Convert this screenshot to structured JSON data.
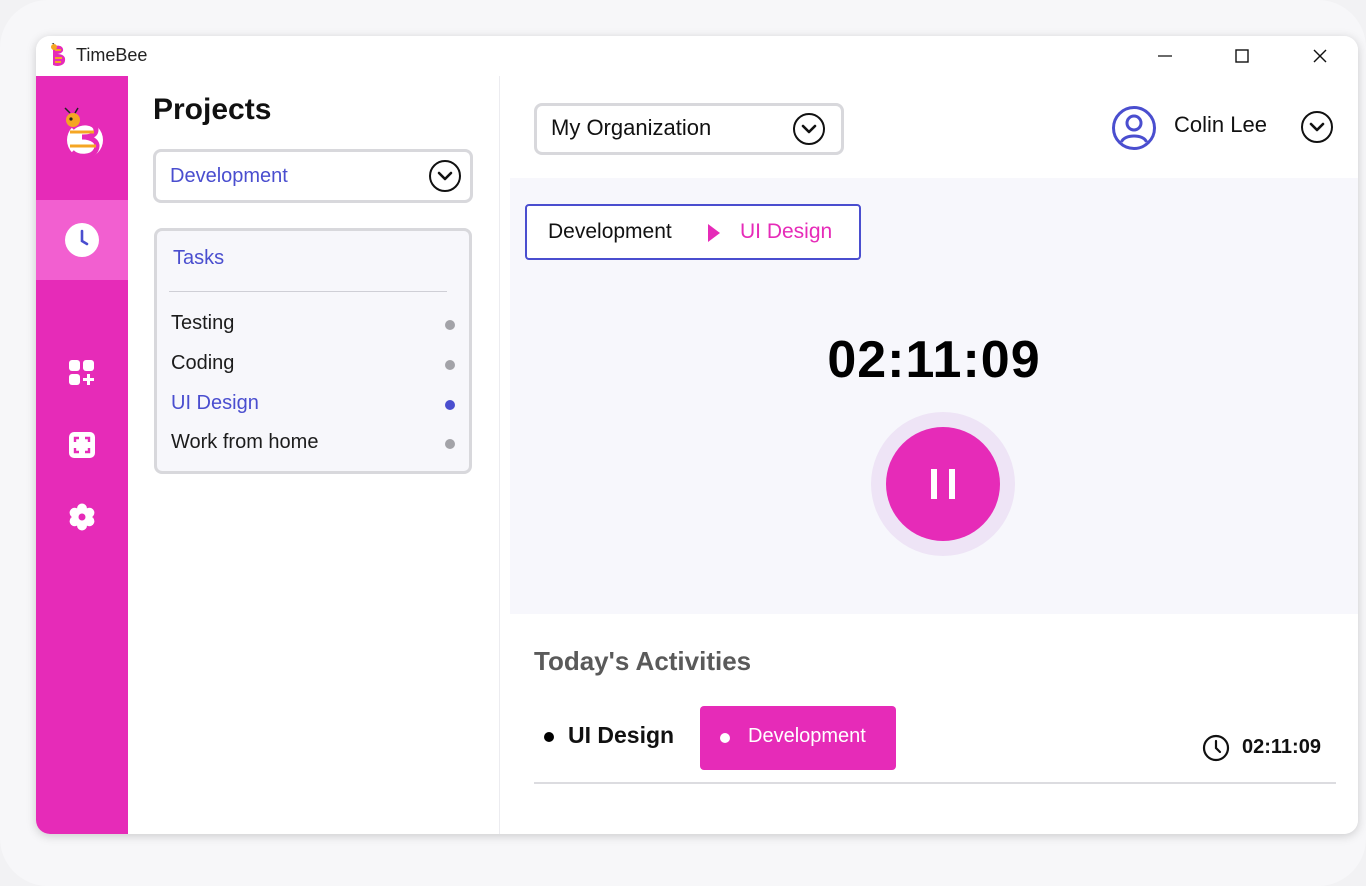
{
  "window": {
    "app_title": "TimeBee"
  },
  "colors": {
    "brand": "#e62bb8",
    "brand_active": "#f25fd0",
    "accent": "#4a4ecf"
  },
  "rail": {
    "items": [
      {
        "icon": "clock-icon",
        "active": true
      },
      {
        "icon": "add-apps-icon",
        "active": false
      },
      {
        "icon": "screenshot-icon",
        "active": false
      },
      {
        "icon": "settings-icon",
        "active": false
      }
    ]
  },
  "projects": {
    "title": "Projects",
    "selected_project": "Development",
    "tasks_title": "Tasks",
    "tasks": [
      {
        "label": "Testing",
        "active": false
      },
      {
        "label": "Coding",
        "active": false
      },
      {
        "label": "UI Design",
        "active": true
      },
      {
        "label": "Work from home",
        "active": false
      }
    ]
  },
  "header": {
    "organization": "My Organization",
    "user_name": "Colin Lee"
  },
  "timer": {
    "breadcrumb_parent": "Development",
    "breadcrumb_current": "UI Design",
    "elapsed": "02:11:09"
  },
  "activities": {
    "title": "Today's Activities",
    "items": [
      {
        "task": "UI Design",
        "project": "Development",
        "duration": "02:11:09"
      }
    ]
  }
}
